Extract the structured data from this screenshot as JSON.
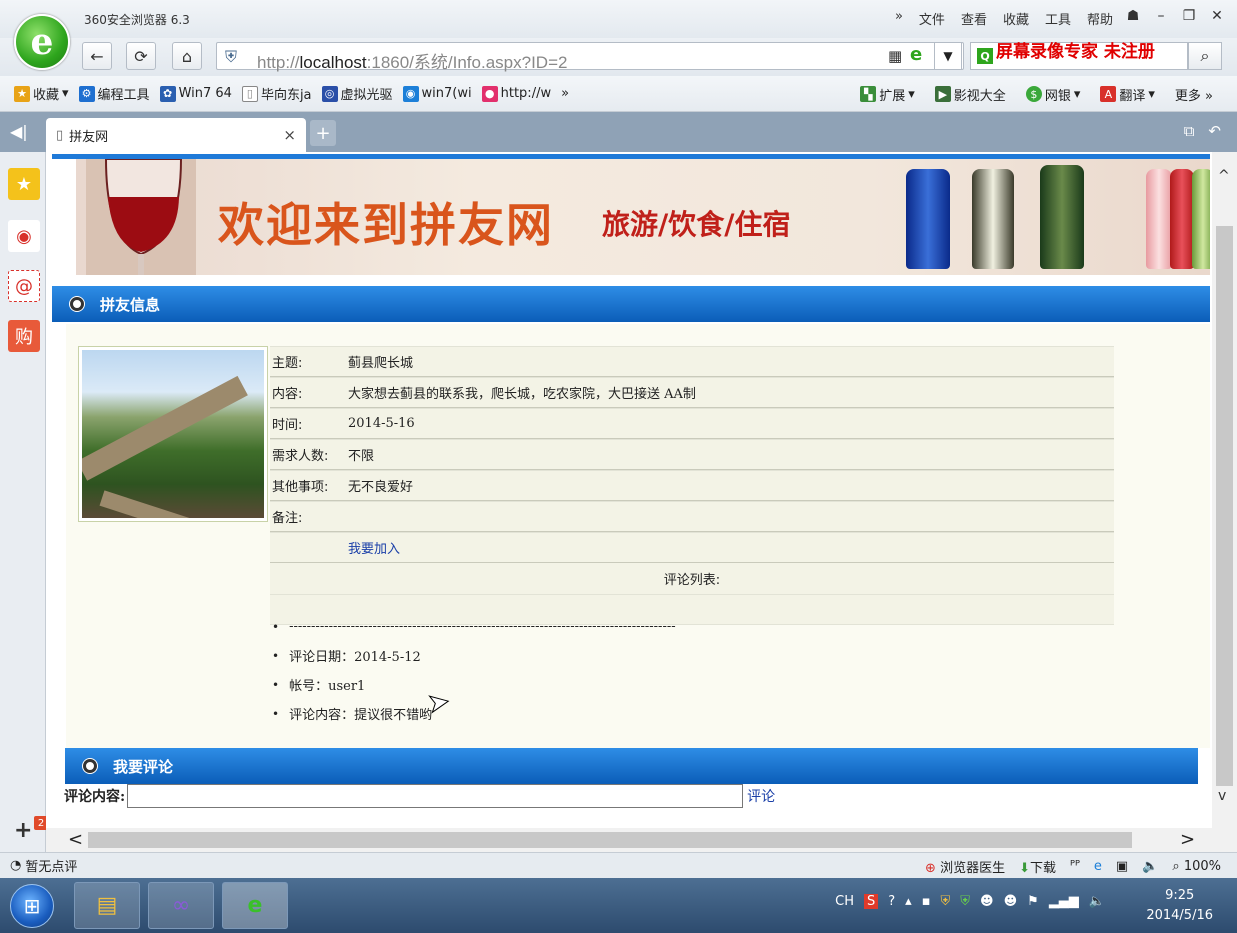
{
  "browser": {
    "app_title": "360安全浏览器 6.3",
    "menu": [
      "文件",
      "查看",
      "收藏",
      "工具",
      "帮助"
    ],
    "more_arrow": "»",
    "url_prefix": "http://",
    "url_host": "localhost",
    "url_rest": ":1860/系统/Info.aspx?ID=2",
    "search_overlay": "屏幕录像专家  未注册"
  },
  "favorites": {
    "items": [
      {
        "label": "收藏",
        "icon": "star-folder-icon"
      },
      {
        "label": "编程工具",
        "icon": "code-icon"
      },
      {
        "label": "Win7 64",
        "icon": "paw-icon"
      },
      {
        "label": "毕向东ja",
        "icon": "page-icon"
      },
      {
        "label": "虚拟光驱",
        "icon": "disc-icon"
      },
      {
        "label": "win7(wi",
        "icon": "win-icon"
      },
      {
        "label": "http://w",
        "icon": "bubble-icon"
      }
    ],
    "overflow": "»",
    "right": [
      {
        "label": "扩展",
        "icon": "puzzle-icon"
      },
      {
        "label": "影视大全",
        "icon": "film-icon"
      },
      {
        "label": "网银",
        "icon": "bank-icon"
      },
      {
        "label": "翻译",
        "icon": "translate-icon"
      },
      {
        "label": "更多 »",
        "icon": ""
      }
    ]
  },
  "tab": {
    "title": "拼友网",
    "close": "×",
    "new": "+"
  },
  "banner": {
    "title": "欢迎来到拼友网",
    "subtitle": "旅游/饮食/住宿"
  },
  "section_info": {
    "title": "拼友信息"
  },
  "info": {
    "rows": [
      {
        "label": "主题:",
        "value": "蓟县爬长城"
      },
      {
        "label": "内容:",
        "value": "大家想去蓟县的联系我，爬长城，吃农家院，大巴接送 AA制"
      },
      {
        "label": "时间:",
        "value": "2014-5-16"
      },
      {
        "label": "需求人数:",
        "value": "不限"
      },
      {
        "label": "其他事项:",
        "value": "无不良爱好"
      },
      {
        "label": "备注:",
        "value": ""
      }
    ],
    "join_link": "我要加入",
    "comments_title": "评论列表:"
  },
  "comments": {
    "items": [
      "----------------------------------------------------------------------------------------",
      "评论日期：2014-5-12",
      "帐号：user1",
      "评论内容：提议很不错哟"
    ]
  },
  "section_comment": {
    "title": "我要评论"
  },
  "comment_form": {
    "label": "评论内容:",
    "value": "",
    "submit": "评论"
  },
  "statusbar": {
    "left": "暂无点评",
    "doctor": "浏览器医生",
    "download": "下载",
    "zoom": "100%"
  },
  "taskbar": {
    "ime": "CH",
    "time": "9:25",
    "date": "2014/5/16"
  },
  "sidebar": {
    "badge": "2"
  },
  "colors": {
    "accent_blue": "#1f7ad8",
    "banner_title": "#d9551c",
    "banner_sub": "#c0201a",
    "link": "#1a3fa8"
  }
}
